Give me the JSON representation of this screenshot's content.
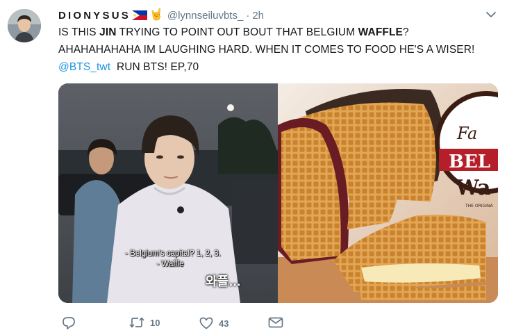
{
  "user": {
    "display_name": "DIONYSUS",
    "handle": "@lynnseiluvbts_",
    "separator": "·",
    "time": "2h",
    "flag_icon": "philippines-flag-icon",
    "hand_emoji": "🤘"
  },
  "tweet": {
    "line1_pre": "IS THIS ",
    "line1_bold1": "JIN",
    "line1_mid": " TRYING TO POINT OUT BOUT THAT BELGIUM ",
    "line1_bold2": "WAFFLE",
    "line1_post": "?",
    "line2": "AHAHAHAHAHA IM LAUGHING HARD. WHEN IT COMES TO FOOD HE'S A WISER!",
    "mention": "@BTS_twt",
    "line3_post": "RUN BTS! EP,70"
  },
  "media": {
    "subtitle_line1": "- Belgium's capital? 1, 2, 3.",
    "subtitle_line2": "- Waffle",
    "korean_caption": "와플…",
    "sign_text1": "Fa",
    "sign_text2": "BEL",
    "sign_text3": "Wa",
    "sign_text4": "THE ORIGINA"
  },
  "actions": {
    "reply_icon": "reply-icon",
    "retweet_count": "10",
    "like_count": "43",
    "dm_icon": "direct-message-icon"
  },
  "colors": {
    "link": "#1b95e0",
    "secondary": "#657786",
    "text": "#14171a"
  }
}
